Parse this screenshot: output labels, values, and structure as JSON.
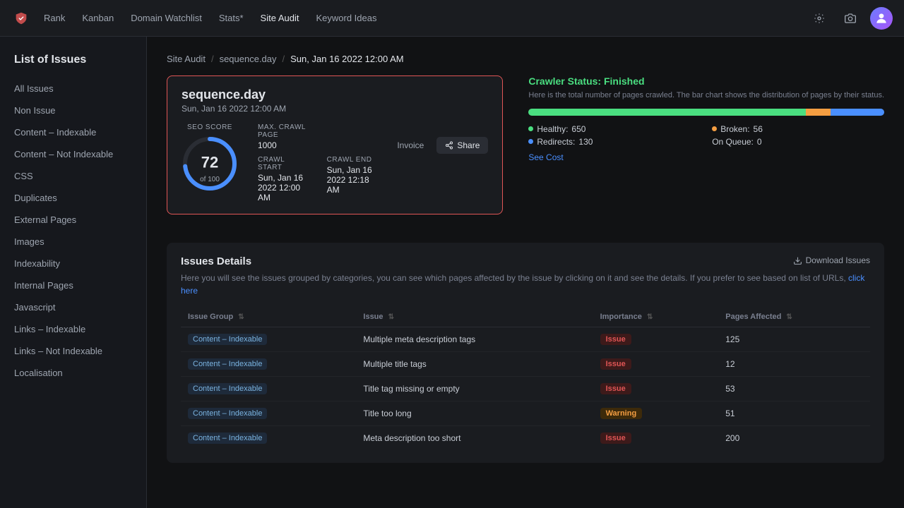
{
  "topbar": {
    "logo_alt": "App Logo",
    "nav_items": [
      {
        "id": "rank",
        "label": "Rank",
        "active": false
      },
      {
        "id": "kanban",
        "label": "Kanban",
        "active": false
      },
      {
        "id": "domain-watchlist",
        "label": "Domain Watchlist",
        "active": false
      },
      {
        "id": "stats",
        "label": "Stats*",
        "active": false
      },
      {
        "id": "site-audit",
        "label": "Site Audit",
        "active": true
      },
      {
        "id": "keyword-ideas",
        "label": "Keyword Ideas",
        "active": false
      }
    ]
  },
  "sidebar": {
    "title": "List of Issues",
    "items": [
      {
        "id": "all-issues",
        "label": "All Issues",
        "active": false
      },
      {
        "id": "non-issue",
        "label": "Non Issue",
        "active": false
      },
      {
        "id": "content-indexable",
        "label": "Content – Indexable",
        "active": false
      },
      {
        "id": "content-not-indexable",
        "label": "Content – Not Indexable",
        "active": false
      },
      {
        "id": "css",
        "label": "CSS",
        "active": false
      },
      {
        "id": "duplicates",
        "label": "Duplicates",
        "active": false
      },
      {
        "id": "external-pages",
        "label": "External Pages",
        "active": false
      },
      {
        "id": "images",
        "label": "Images",
        "active": false
      },
      {
        "id": "indexability",
        "label": "Indexability",
        "active": false
      },
      {
        "id": "internal-pages",
        "label": "Internal Pages",
        "active": false
      },
      {
        "id": "javascript",
        "label": "Javascript",
        "active": false
      },
      {
        "id": "links-indexable",
        "label": "Links – Indexable",
        "active": false
      },
      {
        "id": "links-not-indexable",
        "label": "Links – Not Indexable",
        "active": false
      },
      {
        "id": "localisation",
        "label": "Localisation",
        "active": false
      }
    ]
  },
  "breadcrumb": {
    "site_audit": "Site Audit",
    "sep1": "/",
    "domain": "sequence.day",
    "sep2": "/",
    "current": "Sun, Jan 16 2022 12:00 AM"
  },
  "audit_card": {
    "domain": "sequence.day",
    "date": "Sun, Jan 16 2022 12:00 AM",
    "seo_score_label": "SEO SCORE",
    "score": "72",
    "score_of": "of 100",
    "max_crawl_label": "MAX. CRAWL PAGE",
    "max_crawl_value": "1000",
    "crawl_start_label": "CRAWL START",
    "crawl_start_value": "Sun, Jan 16 2022 12:00 AM",
    "crawl_end_label": "CRAWL END",
    "crawl_end_value": "Sun, Jan 16 2022 12:18 AM",
    "btn_invoice": "Invoice",
    "btn_share": "Share"
  },
  "crawler_status": {
    "label": "Crawler Status:",
    "status": "Finished",
    "description": "Here is the total number of pages crawled. The bar chart shows the distribution of pages by their status.",
    "healthy_label": "Healthy:",
    "healthy_count": "650",
    "broken_label": "Broken:",
    "broken_count": "56",
    "redirects_label": "Redirects:",
    "redirects_count": "130",
    "on_queue_label": "On Queue:",
    "on_queue_count": "0",
    "see_cost": "See Cost",
    "bar_healthy_pct": 78,
    "bar_broken_pct": 7,
    "bar_redirect_pct": 15
  },
  "issues_section": {
    "title": "Issues Details",
    "description": "Here you will see the issues grouped by categories, you can see which pages affected by the issue by clicking on it and see the details. If you prefer to see based on list of URLs,",
    "click_here": "click here",
    "download_label": "Download Issues",
    "table": {
      "headers": [
        {
          "id": "issue-group",
          "label": "Issue Group"
        },
        {
          "id": "issue",
          "label": "Issue"
        },
        {
          "id": "importance",
          "label": "Importance"
        },
        {
          "id": "pages-affected",
          "label": "Pages Affected"
        }
      ],
      "rows": [
        {
          "group": "Content – Indexable",
          "issue": "Multiple meta description tags",
          "importance": "Issue",
          "importance_type": "issue",
          "pages": "125"
        },
        {
          "group": "Content – Indexable",
          "issue": "Multiple title tags",
          "importance": "Issue",
          "importance_type": "issue",
          "pages": "12"
        },
        {
          "group": "Content – Indexable",
          "issue": "Title tag missing or empty",
          "importance": "Issue",
          "importance_type": "issue",
          "pages": "53"
        },
        {
          "group": "Content – Indexable",
          "issue": "Title too long",
          "importance": "Warning",
          "importance_type": "warning",
          "pages": "51"
        },
        {
          "group": "Content – Indexable",
          "issue": "Meta description too short",
          "importance": "Issue",
          "importance_type": "issue",
          "pages": "200"
        }
      ]
    }
  }
}
